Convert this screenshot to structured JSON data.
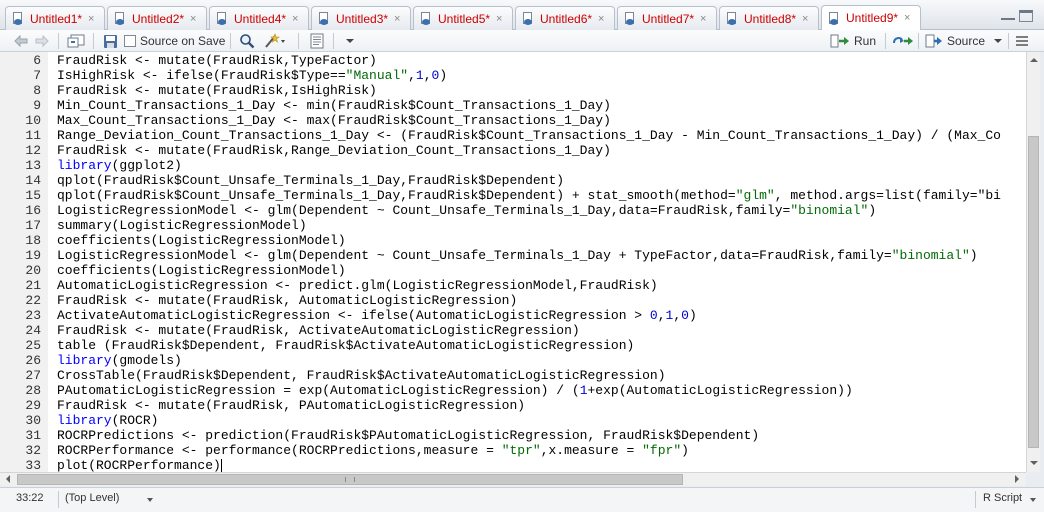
{
  "tabs": [
    {
      "label": "Untitled1*",
      "active": false
    },
    {
      "label": "Untitled2*",
      "active": false
    },
    {
      "label": "Untitled4*",
      "active": false
    },
    {
      "label": "Untitled3*",
      "active": false
    },
    {
      "label": "Untitled5*",
      "active": false
    },
    {
      "label": "Untitled6*",
      "active": false
    },
    {
      "label": "Untitled7*",
      "active": false
    },
    {
      "label": "Untitled8*",
      "active": false
    },
    {
      "label": "Untitled9*",
      "active": true
    }
  ],
  "toolbar": {
    "source_on_save_label": "Source on Save",
    "run_label": "Run",
    "source_label": "Source"
  },
  "editor": {
    "lines": [
      {
        "n": "6",
        "text": "FraudRisk <- mutate(FraudRisk,TypeFactor)"
      },
      {
        "n": "7",
        "text": "IsHighRisk <- ifelse(FraudRisk$Type==\"Manual\",1,0)"
      },
      {
        "n": "8",
        "text": "FraudRisk <- mutate(FraudRisk,IsHighRisk)"
      },
      {
        "n": "9",
        "text": "Min_Count_Transactions_1_Day <- min(FraudRisk$Count_Transactions_1_Day)"
      },
      {
        "n": "10",
        "text": "Max_Count_Transactions_1_Day <- max(FraudRisk$Count_Transactions_1_Day)"
      },
      {
        "n": "11",
        "text": "Range_Deviation_Count_Transactions_1_Day <- (FraudRisk$Count_Transactions_1_Day - Min_Count_Transactions_1_Day) / (Max_Co"
      },
      {
        "n": "12",
        "text": "FraudRisk <- mutate(FraudRisk,Range_Deviation_Count_Transactions_1_Day)"
      },
      {
        "n": "13",
        "text": "library(ggplot2)"
      },
      {
        "n": "14",
        "text": "qplot(FraudRisk$Count_Unsafe_Terminals_1_Day,FraudRisk$Dependent)"
      },
      {
        "n": "15",
        "text": "qplot(FraudRisk$Count_Unsafe_Terminals_1_Day,FraudRisk$Dependent) + stat_smooth(method=\"glm\", method.args=list(family=\"bi"
      },
      {
        "n": "16",
        "text": "LogisticRegressionModel <- glm(Dependent ~ Count_Unsafe_Terminals_1_Day,data=FraudRisk,family=\"binomial\")"
      },
      {
        "n": "17",
        "text": "summary(LogisticRegressionModel)"
      },
      {
        "n": "18",
        "text": "coefficients(LogisticRegressionModel)"
      },
      {
        "n": "19",
        "text": "LogisticRegressionModel <- glm(Dependent ~ Count_Unsafe_Terminals_1_Day + TypeFactor,data=FraudRisk,family=\"binomial\")"
      },
      {
        "n": "20",
        "text": "coefficients(LogisticRegressionModel)"
      },
      {
        "n": "21",
        "text": "AutomaticLogisticRegression <- predict.glm(LogisticRegressionModel,FraudRisk)"
      },
      {
        "n": "22",
        "text": "FraudRisk <- mutate(FraudRisk, AutomaticLogisticRegression)"
      },
      {
        "n": "23",
        "text": "ActivateAutomaticLogisticRegression <- ifelse(AutomaticLogisticRegression > 0,1,0)"
      },
      {
        "n": "24",
        "text": "FraudRisk <- mutate(FraudRisk, ActivateAutomaticLogisticRegression)"
      },
      {
        "n": "25",
        "text": "table (FraudRisk$Dependent, FraudRisk$ActivateAutomaticLogisticRegression)"
      },
      {
        "n": "26",
        "text": "library(gmodels)"
      },
      {
        "n": "27",
        "text": "CrossTable(FraudRisk$Dependent, FraudRisk$ActivateAutomaticLogisticRegression)"
      },
      {
        "n": "28",
        "text": "PAutomaticLogisticRegression = exp(AutomaticLogisticRegression) / (1+exp(AutomaticLogisticRegression))"
      },
      {
        "n": "29",
        "text": "FraudRisk <- mutate(FraudRisk, PAutomaticLogisticRegression)"
      },
      {
        "n": "30",
        "text": "library(ROCR)"
      },
      {
        "n": "31",
        "text": "ROCRPredictions <- prediction(FraudRisk$PAutomaticLogisticRegression, FraudRisk$Dependent)"
      },
      {
        "n": "32",
        "text": "ROCRPerformance <- performance(ROCRPredictions,measure = \"tpr\",x.measure = \"fpr\")"
      },
      {
        "n": "33",
        "text": "plot(ROCRPerformance)"
      }
    ]
  },
  "status": {
    "position": "33:22",
    "scope": "(Top Level)",
    "filetype": "R Script"
  },
  "colors": {
    "tab_text": "#cc0000",
    "keyword": "#0000ff",
    "string": "#036a07",
    "number": "#0000cd"
  }
}
